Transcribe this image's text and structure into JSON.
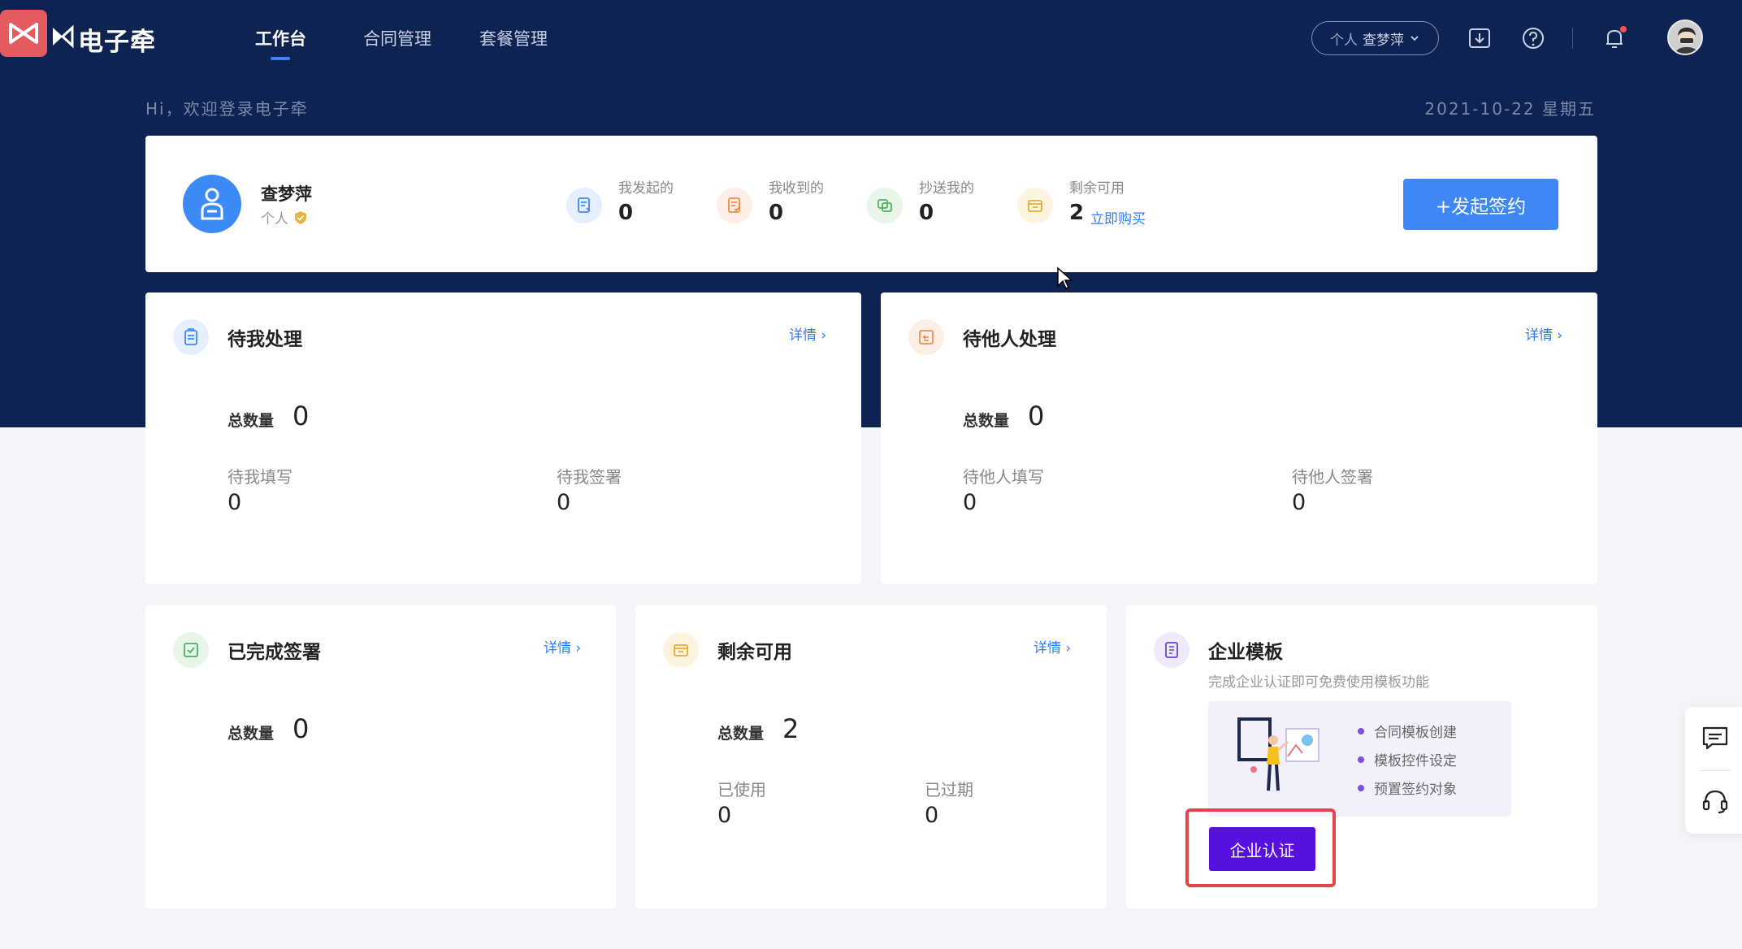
{
  "app": {
    "brand": "电子牵",
    "colors": {
      "nav_bg": "#0f2353",
      "primary": "#3f87f5",
      "purple": "#5610e0",
      "highlight": "#e2444b"
    }
  },
  "nav": {
    "items": [
      {
        "label": "工作台",
        "active": true
      },
      {
        "label": "合同管理",
        "active": false
      },
      {
        "label": "套餐管理",
        "active": false
      }
    ],
    "account_tag": "个人",
    "account_name": "查梦萍",
    "icons": [
      "download-icon",
      "help-icon",
      "bell-icon",
      "avatar"
    ]
  },
  "welcome": "Hi，欢迎登录电子牵",
  "date": "2021-10-22 星期五",
  "profile": {
    "name": "查梦萍",
    "type": "个人",
    "stats": [
      {
        "label": "我发起的",
        "value": "0",
        "icon": "sent-doc-icon"
      },
      {
        "label": "我收到的",
        "value": "0",
        "icon": "received-doc-icon"
      },
      {
        "label": "抄送我的",
        "value": "0",
        "icon": "cc-icon"
      },
      {
        "label": "剩余可用",
        "value": "2",
        "icon": "wallet-icon",
        "link": "立即购买"
      }
    ],
    "start_button": "+发起签约"
  },
  "cards": {
    "pending_me": {
      "title": "待我处理",
      "detail": "详情 ›",
      "total_label": "总数量",
      "total": "0",
      "sub": [
        {
          "label": "待我填写",
          "value": "0"
        },
        {
          "label": "待我签署",
          "value": "0"
        }
      ]
    },
    "pending_others": {
      "title": "待他人处理",
      "detail": "详情 ›",
      "total_label": "总数量",
      "total": "0",
      "sub": [
        {
          "label": "待他人填写",
          "value": "0"
        },
        {
          "label": "待他人签署",
          "value": "0"
        }
      ]
    },
    "completed": {
      "title": "已完成签署",
      "detail": "详情 ›",
      "total_label": "总数量",
      "total": "0"
    },
    "remaining": {
      "title": "剩余可用",
      "detail": "详情 ›",
      "total_label": "总数量",
      "total": "2",
      "sub": [
        {
          "label": "已使用",
          "value": "0"
        },
        {
          "label": "已过期",
          "value": "0"
        }
      ]
    },
    "template": {
      "title": "企业模板",
      "subtitle": "完成企业认证即可免费使用模板功能",
      "features": [
        "合同模板创建",
        "模板控件设定",
        "预置签约对象"
      ],
      "button": "企业认证"
    }
  },
  "float_panel": {
    "icons": [
      "message-icon",
      "headset-icon"
    ]
  }
}
